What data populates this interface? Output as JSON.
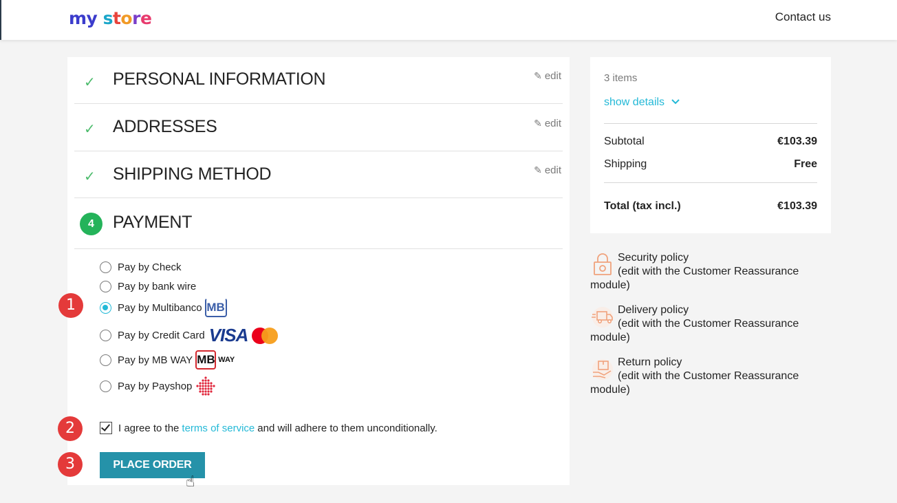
{
  "header": {
    "logo": {
      "p1": "my",
      "p2": "s",
      "p3": "t",
      "p4": "o",
      "p5": "r",
      "p6": "e"
    },
    "contact_label": "Contact us"
  },
  "steps": {
    "personal": {
      "title": "PERSONAL INFORMATION",
      "edit_label": "edit"
    },
    "addresses": {
      "title": "ADDRESSES",
      "edit_label": "edit"
    },
    "shipping": {
      "title": "SHIPPING METHOD",
      "edit_label": "edit"
    },
    "payment": {
      "number": "4",
      "title": "PAYMENT"
    }
  },
  "payment_options": [
    {
      "label": "Pay by Check",
      "checked": false
    },
    {
      "label": "Pay by bank wire",
      "checked": false
    },
    {
      "label": "Pay by Multibanco",
      "checked": true,
      "logo": "MB"
    },
    {
      "label": "Pay by Credit Card",
      "checked": false,
      "logo": "VISA"
    },
    {
      "label": "Pay by MB WAY",
      "checked": false,
      "logo_box": "MB",
      "logo_suffix": "WAY"
    },
    {
      "label": "Pay by Payshop",
      "checked": false
    }
  ],
  "terms": {
    "prefix": "I agree to the",
    "link": "terms of service",
    "suffix": "and will adhere to them unconditionally.",
    "checked": true
  },
  "place_order_label": "PLACE ORDER",
  "annotations": {
    "b1": "1",
    "b2": "2",
    "b3": "3"
  },
  "summary": {
    "items_count": "3 items",
    "show_details": "show details",
    "subtotal_label": "Subtotal",
    "subtotal_value": "€103.39",
    "shipping_label": "Shipping",
    "shipping_value": "Free",
    "total_label": "Total (tax incl.)",
    "total_value": "€103.39"
  },
  "reassurance": [
    {
      "name": "Security policy",
      "desc1": "(edit with the Customer Reassurance",
      "desc2": "module)",
      "icon": "lock-icon"
    },
    {
      "name": "Delivery policy",
      "desc1": "(edit with the Customer Reassurance",
      "desc2": "module)",
      "icon": "truck-icon"
    },
    {
      "name": "Return policy",
      "desc1": "(edit with the Customer Reassurance",
      "desc2": "module)",
      "icon": "return-package-icon"
    }
  ],
  "colors": {
    "accent": "#24b9d7",
    "button": "#2592a9",
    "check_green": "#4cbb6c",
    "step_green": "#24b35a",
    "badge_red": "#e43a3a"
  }
}
